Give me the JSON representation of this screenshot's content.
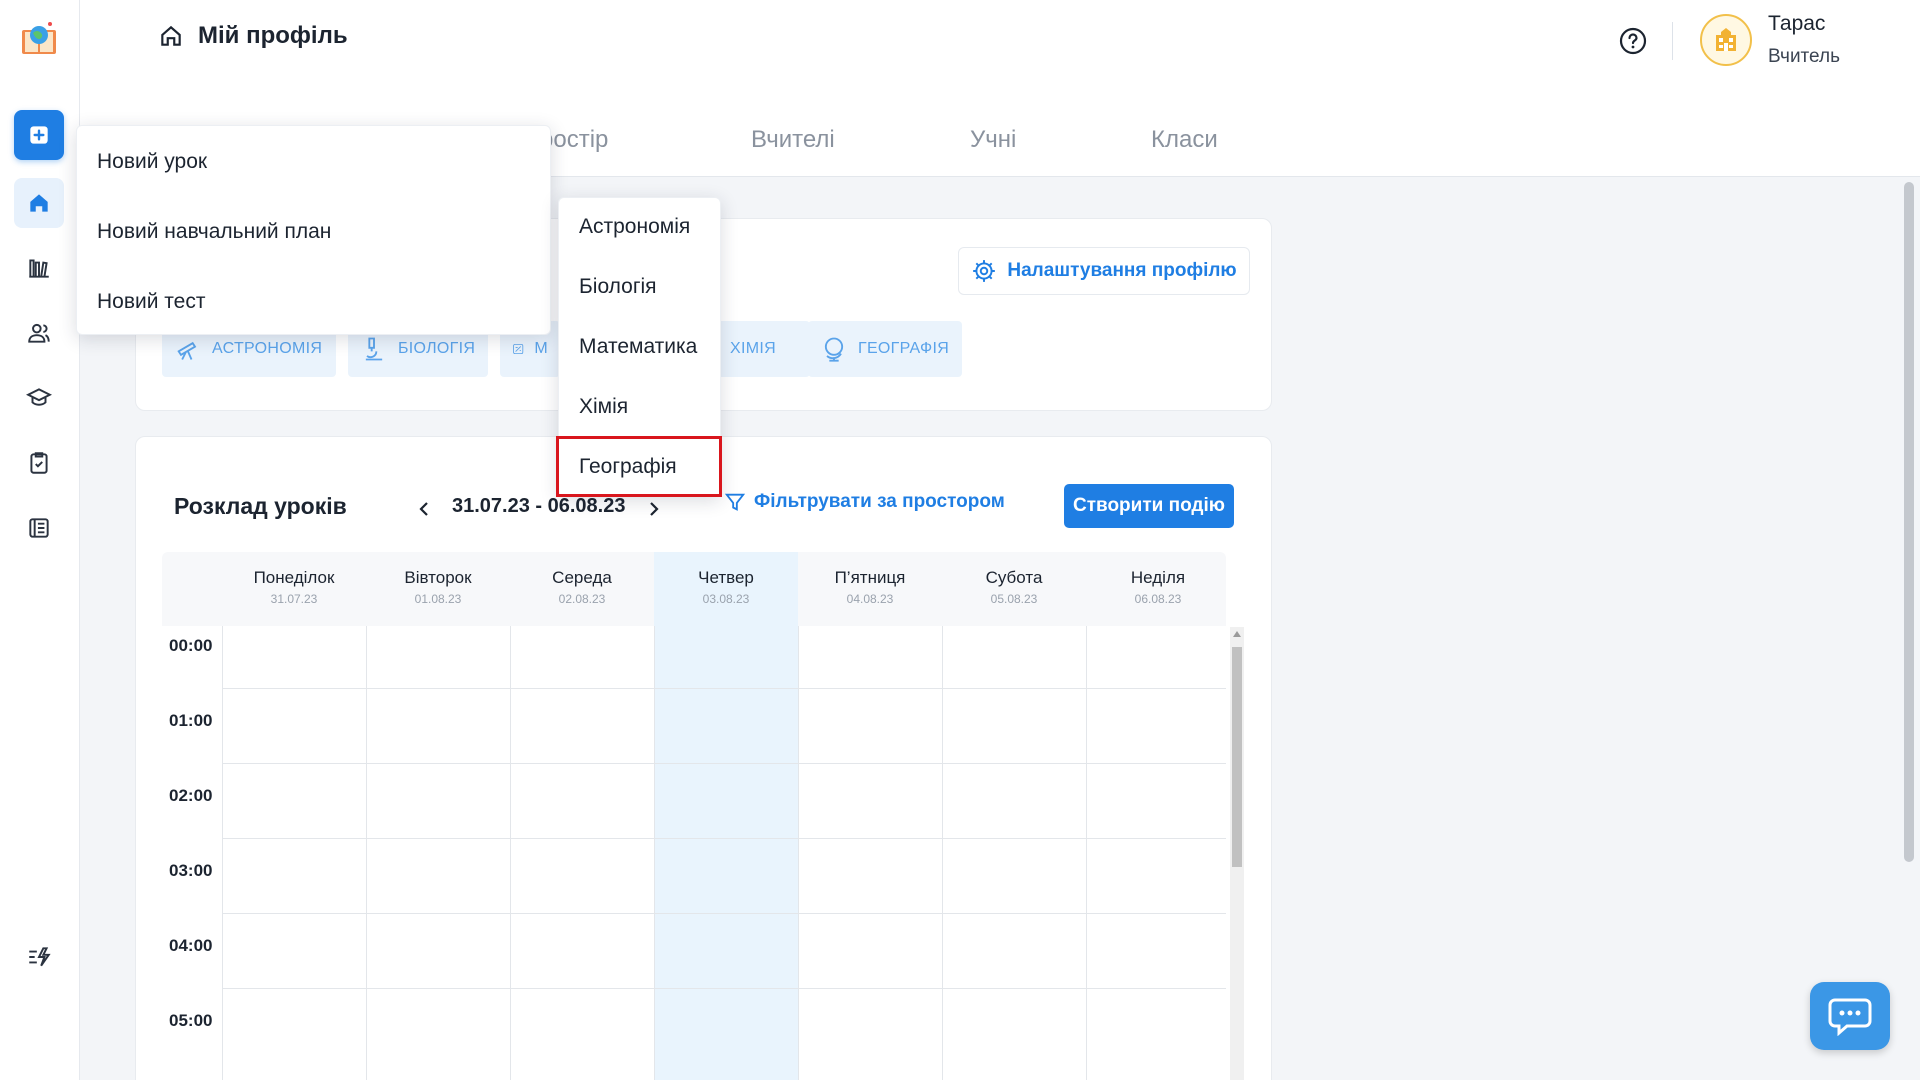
{
  "header": {
    "title": "Мій профіль",
    "user_name": "Тарас",
    "user_role": "Вчитель"
  },
  "tabs": [
    {
      "label": "ростір"
    },
    {
      "label": "Вчителі"
    },
    {
      "label": "Учні"
    },
    {
      "label": "Класи"
    }
  ],
  "profile": {
    "settings_label": "Налаштування профілю",
    "chips": [
      "Астрономія",
      "Біологія",
      "М",
      "Хімія",
      "Географія"
    ]
  },
  "schedule": {
    "title": "Розклад уроків",
    "date_range": "31.07.23 - 06.08.23",
    "filter_label": "Фільтрувати за простором",
    "create_label": "Створити подію",
    "days": [
      {
        "name": "Понеділок",
        "date": "31.07.23"
      },
      {
        "name": "Вівторок",
        "date": "01.08.23"
      },
      {
        "name": "Середа",
        "date": "02.08.23"
      },
      {
        "name": "Четвер",
        "date": "03.08.23"
      },
      {
        "name": "П’ятниця",
        "date": "04.08.23"
      },
      {
        "name": "Субота",
        "date": "05.08.23"
      },
      {
        "name": "Неділя",
        "date": "06.08.23"
      }
    ],
    "hours": [
      "00:00",
      "01:00",
      "02:00",
      "03:00",
      "04:00",
      "05:00"
    ]
  },
  "new_menu": {
    "items": [
      "Новий урок",
      "Новий навчальний план",
      "Новий тест"
    ]
  },
  "subject_menu": {
    "items": [
      "Астрономія",
      "Біологія",
      "Математика",
      "Хімія",
      "Географія"
    ],
    "highlighted": "Географія"
  },
  "colors": {
    "accent": "#1f7ee3",
    "today_column": "#e9f4fd",
    "highlight_border": "#d9161d"
  }
}
